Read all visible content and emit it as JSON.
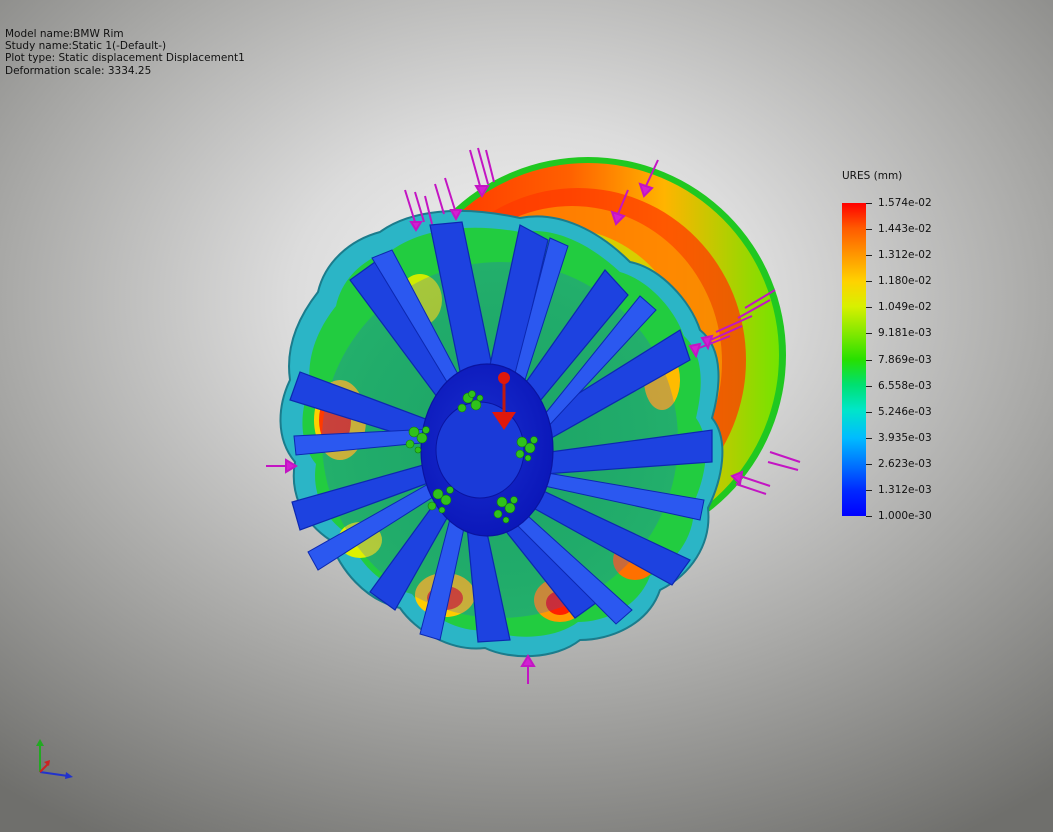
{
  "info": {
    "model_name": "Model name:BMW Rim",
    "study_name": "Study name:Static 1(-Default-)",
    "plot_type": "Plot type: Static displacement Displacement1",
    "deformation_scale": "Deformation scale: 3334.25"
  },
  "legend": {
    "title": "URES (mm)",
    "ticks": [
      "1.574e-02",
      "1.443e-02",
      "1.312e-02",
      "1.180e-02",
      "1.049e-02",
      "9.181e-03",
      "7.869e-03",
      "6.558e-03",
      "5.246e-03",
      "3.935e-03",
      "2.623e-03",
      "1.312e-03",
      "1.000e-30"
    ],
    "colors": {
      "max": "#ff0000",
      "mid": "#27e000",
      "min": "#0000ff"
    }
  },
  "scene": {
    "model": "bmw-rim-wheel",
    "load_arrow_color": "#d21fd2",
    "fixture_color": "#33c21a",
    "remote_load_color": "#e0180c",
    "hub_color": "#1a3cd9",
    "rim_edge_color": "#26b7c4"
  },
  "triad": {
    "axes": [
      "y-axis-icon",
      "x-axis-icon",
      "z-axis-icon"
    ]
  }
}
